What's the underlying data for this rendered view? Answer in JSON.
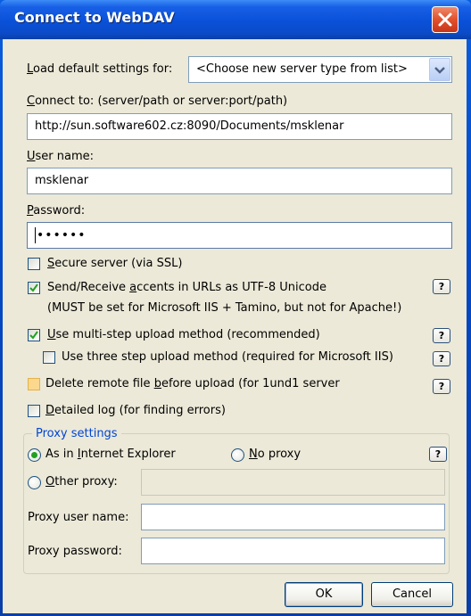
{
  "window": {
    "title": "Connect to WebDAV"
  },
  "load_defaults": {
    "label_pre": "",
    "label_u": "L",
    "label_post": "oad default settings for:",
    "value": "<Choose new server type from list>"
  },
  "connect_to": {
    "label_u": "C",
    "label_post": "onnect to: (server/path or server:port/path)",
    "value": "http://sun.software602.cz:8090/Documents/msklenar"
  },
  "user_name": {
    "label_u": "U",
    "label_post": "ser name:",
    "value": "msklenar"
  },
  "password": {
    "label_u": "P",
    "label_post": "assword:",
    "value": "••••••"
  },
  "options": {
    "secure": {
      "pre": "",
      "u": "S",
      "post": "ecure server (via SSL)",
      "checked": false
    },
    "utf8": {
      "pre": "Send/Receive ",
      "u": "a",
      "post": "ccents in URLs as UTF-8 Unicode",
      "checked": true,
      "note": "(MUST be set for Microsoft IIS + Tamino, but not for Apache!)"
    },
    "multistep": {
      "pre": "",
      "u": "U",
      "post": "se multi-step upload method (recommended)",
      "checked": true
    },
    "threestep": {
      "pre": "Use three step upload method (required for Microsoft IIS)",
      "checked": false
    },
    "delete_remote": {
      "pre": "Delete remote file ",
      "u": "b",
      "post": "efore upload (for 1und1 server",
      "checked": false
    },
    "detailed_log": {
      "pre": "",
      "u": "D",
      "post": "etailed log (for finding errors)",
      "checked": false
    }
  },
  "proxy": {
    "legend": "Proxy settings",
    "as_ie": {
      "pre": "As in ",
      "u": "I",
      "post": "nternet Explorer",
      "selected": true
    },
    "no_proxy": {
      "u": "N",
      "post": "o proxy",
      "selected": false
    },
    "other": {
      "u": "O",
      "post": "ther proxy:",
      "selected": false,
      "value": ""
    },
    "user_label": "Proxy user name:",
    "user_value": "",
    "password_label": "Proxy password:",
    "password_value": ""
  },
  "help_label": "?",
  "buttons": {
    "ok": "OK",
    "cancel": "Cancel"
  }
}
